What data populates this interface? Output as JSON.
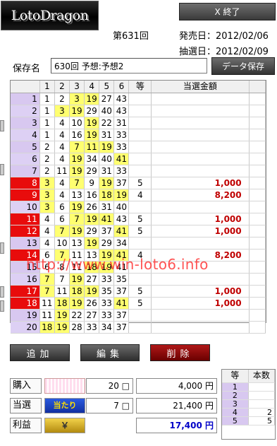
{
  "app": {
    "logo_text": "LotoDragon",
    "exit_label": "X 終了"
  },
  "header": {
    "draw_no": "第631回",
    "sale_date": "発売日：2012/02/06",
    "draw_date": "抽選日：2012/02/09"
  },
  "save": {
    "label": "保存名",
    "value": "630回 予想:予想2",
    "button": "データ保存"
  },
  "grid": {
    "columns": [
      "",
      "1",
      "2",
      "3",
      "4",
      "5",
      "6",
      "等",
      "当選金額"
    ],
    "rows": [
      {
        "idx": "1",
        "nums": [
          "1",
          "2",
          "3",
          "19",
          "27",
          "43"
        ],
        "hl": [
          false,
          false,
          true,
          true,
          false,
          false
        ],
        "rank": "",
        "amount": "",
        "hit": false
      },
      {
        "idx": "2",
        "nums": [
          "1",
          "3",
          "19",
          "29",
          "40",
          "43"
        ],
        "hl": [
          false,
          true,
          true,
          false,
          false,
          false
        ],
        "rank": "",
        "amount": "",
        "hit": false
      },
      {
        "idx": "3",
        "nums": [
          "1",
          "4",
          "10",
          "19",
          "22",
          "31"
        ],
        "hl": [
          false,
          false,
          false,
          true,
          false,
          false
        ],
        "rank": "",
        "amount": "",
        "hit": false
      },
      {
        "idx": "4",
        "nums": [
          "1",
          "4",
          "16",
          "19",
          "31",
          "33"
        ],
        "hl": [
          false,
          false,
          false,
          true,
          false,
          false
        ],
        "rank": "",
        "amount": "",
        "hit": false
      },
      {
        "idx": "5",
        "nums": [
          "2",
          "4",
          "7",
          "11",
          "19",
          "33"
        ],
        "hl": [
          false,
          false,
          true,
          true,
          true,
          false
        ],
        "rank": "",
        "amount": "",
        "hit": false
      },
      {
        "idx": "6",
        "nums": [
          "2",
          "4",
          "19",
          "34",
          "40",
          "41"
        ],
        "hl": [
          false,
          false,
          true,
          false,
          false,
          true
        ],
        "rank": "",
        "amount": "",
        "hit": false
      },
      {
        "idx": "7",
        "nums": [
          "2",
          "11",
          "19",
          "29",
          "31",
          "33"
        ],
        "hl": [
          false,
          false,
          true,
          false,
          false,
          false
        ],
        "rank": "",
        "amount": "",
        "hit": false
      },
      {
        "idx": "8",
        "nums": [
          "3",
          "4",
          "7",
          "9",
          "19",
          "37"
        ],
        "hl": [
          true,
          false,
          true,
          false,
          true,
          false
        ],
        "rank": "5",
        "amount": "1,000",
        "hit": true
      },
      {
        "idx": "9",
        "nums": [
          "3",
          "4",
          "13",
          "16",
          "18",
          "19"
        ],
        "hl": [
          true,
          false,
          false,
          false,
          true,
          true
        ],
        "rank": "4",
        "amount": "8,200",
        "hit": true
      },
      {
        "idx": "10",
        "nums": [
          "3",
          "6",
          "19",
          "26",
          "31",
          "40"
        ],
        "hl": [
          true,
          false,
          true,
          false,
          false,
          false
        ],
        "rank": "",
        "amount": "",
        "hit": false
      },
      {
        "idx": "11",
        "nums": [
          "4",
          "6",
          "7",
          "19",
          "41",
          "43"
        ],
        "hl": [
          false,
          false,
          true,
          true,
          true,
          false
        ],
        "rank": "5",
        "amount": "1,000",
        "hit": true
      },
      {
        "idx": "12",
        "nums": [
          "4",
          "7",
          "19",
          "29",
          "37",
          "41"
        ],
        "hl": [
          false,
          true,
          true,
          false,
          false,
          true
        ],
        "rank": "5",
        "amount": "1,000",
        "hit": true
      },
      {
        "idx": "13",
        "nums": [
          "4",
          "10",
          "13",
          "19",
          "29",
          "34"
        ],
        "hl": [
          false,
          false,
          false,
          true,
          false,
          false
        ],
        "rank": "",
        "amount": "",
        "hit": false
      },
      {
        "idx": "14",
        "nums": [
          "6",
          "7",
          "11",
          "13",
          "19",
          "41"
        ],
        "hl": [
          false,
          true,
          false,
          false,
          true,
          true
        ],
        "rank": "4",
        "amount": "8,200",
        "hit": true
      },
      {
        "idx": "15",
        "nums": [
          "6",
          "8",
          "11",
          "18",
          "19",
          "41"
        ],
        "hl": [
          false,
          false,
          false,
          true,
          true,
          false
        ],
        "rank": "",
        "amount": "",
        "hit": false
      },
      {
        "idx": "16",
        "nums": [
          "7",
          "7",
          "19",
          "27",
          "33",
          "35"
        ],
        "hl": [
          true,
          false,
          true,
          false,
          false,
          false
        ],
        "rank": "",
        "amount": "",
        "hit": false
      },
      {
        "idx": "17",
        "nums": [
          "7",
          "11",
          "18",
          "19",
          "35",
          "37"
        ],
        "hl": [
          true,
          false,
          true,
          true,
          false,
          false
        ],
        "rank": "5",
        "amount": "1,000",
        "hit": true
      },
      {
        "idx": "18",
        "nums": [
          "11",
          "18",
          "19",
          "26",
          "33",
          "41"
        ],
        "hl": [
          false,
          true,
          true,
          false,
          false,
          true
        ],
        "rank": "5",
        "amount": "1,000",
        "hit": true
      },
      {
        "idx": "19",
        "nums": [
          "11",
          "19",
          "22",
          "27",
          "33",
          "37"
        ],
        "hl": [
          false,
          true,
          false,
          false,
          false,
          false
        ],
        "rank": "",
        "amount": "",
        "hit": false
      },
      {
        "idx": "20",
        "nums": [
          "18",
          "19",
          "28",
          "33",
          "34",
          "37"
        ],
        "hl": [
          true,
          true,
          false,
          false,
          false,
          false
        ],
        "rank": "",
        "amount": "",
        "hit": false
      }
    ]
  },
  "watermark": "http://www.win-loto6.info",
  "actions": {
    "add": "追加",
    "edit": "編集",
    "delete": "削除"
  },
  "summary": {
    "buy": {
      "label": "購入",
      "count": "20 □",
      "amount": "4,000 円"
    },
    "hit": {
      "label": "当選",
      "icon_text": "当たり",
      "count": "7 □",
      "amount": "21,400 円"
    },
    "profit": {
      "label": "利益",
      "icon_text": "￥",
      "amount": "17,400 円"
    }
  },
  "rank_table": {
    "headers": [
      "等",
      "本数"
    ],
    "rows": [
      {
        "rank": "1",
        "count": ""
      },
      {
        "rank": "2",
        "count": ""
      },
      {
        "rank": "3",
        "count": ""
      },
      {
        "rank": "4",
        "count": "2"
      },
      {
        "rank": "5",
        "count": "5"
      }
    ]
  },
  "colors": {
    "highlight": "#ffff70",
    "hit_row": "#e80c0c",
    "index_cell": "#d8c8f0",
    "amount_text": "#c00000",
    "profit_text": "#0000c8",
    "delete_button": "#b01818"
  }
}
